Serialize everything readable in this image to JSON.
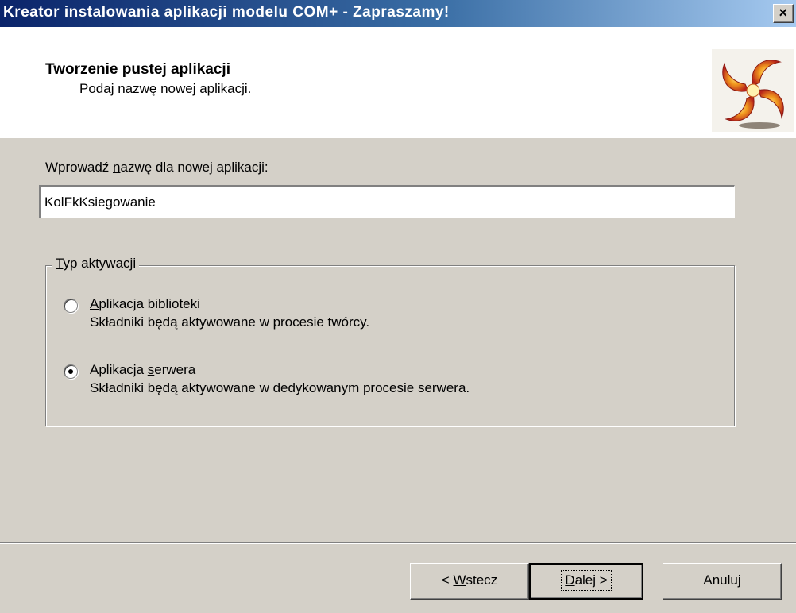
{
  "window": {
    "title": "Kreator instalowania aplikacji modelu COM+ - Zapraszamy!",
    "close_label": "×"
  },
  "header": {
    "title": "Tworzenie pustej aplikacji",
    "subtitle": "Podaj nazwę nowej aplikacji."
  },
  "name_field": {
    "label_pre": "Wprowadź ",
    "label_access": "n",
    "label_post": "azwę dla nowej aplikacji:",
    "value": "KolFkKsiegowanie"
  },
  "activation": {
    "legend_access": "T",
    "legend_rest": "yp aktywacji",
    "options": [
      {
        "title_pre": "",
        "title_access": "A",
        "title_post": "plikacja biblioteki",
        "description": "Składniki będą aktywowane w procesie twórcy.",
        "selected": false
      },
      {
        "title_pre": "Aplikacja ",
        "title_access": "s",
        "title_post": "erwera",
        "description": "Składniki będą aktywowane w dedykowanym procesie serwera.",
        "selected": true
      }
    ]
  },
  "buttons": {
    "back": {
      "pre": "< ",
      "access": "W",
      "post": "stecz"
    },
    "next": {
      "access": "D",
      "post": "alej >"
    },
    "cancel": {
      "label": "Anuluj"
    }
  },
  "icons": {
    "logo": "com-plus-swirl-logo",
    "close": "close-icon"
  },
  "colors": {
    "titlebar_start": "#0a246a",
    "titlebar_end": "#a6caf0",
    "dialog_bg": "#d4d0c8"
  }
}
